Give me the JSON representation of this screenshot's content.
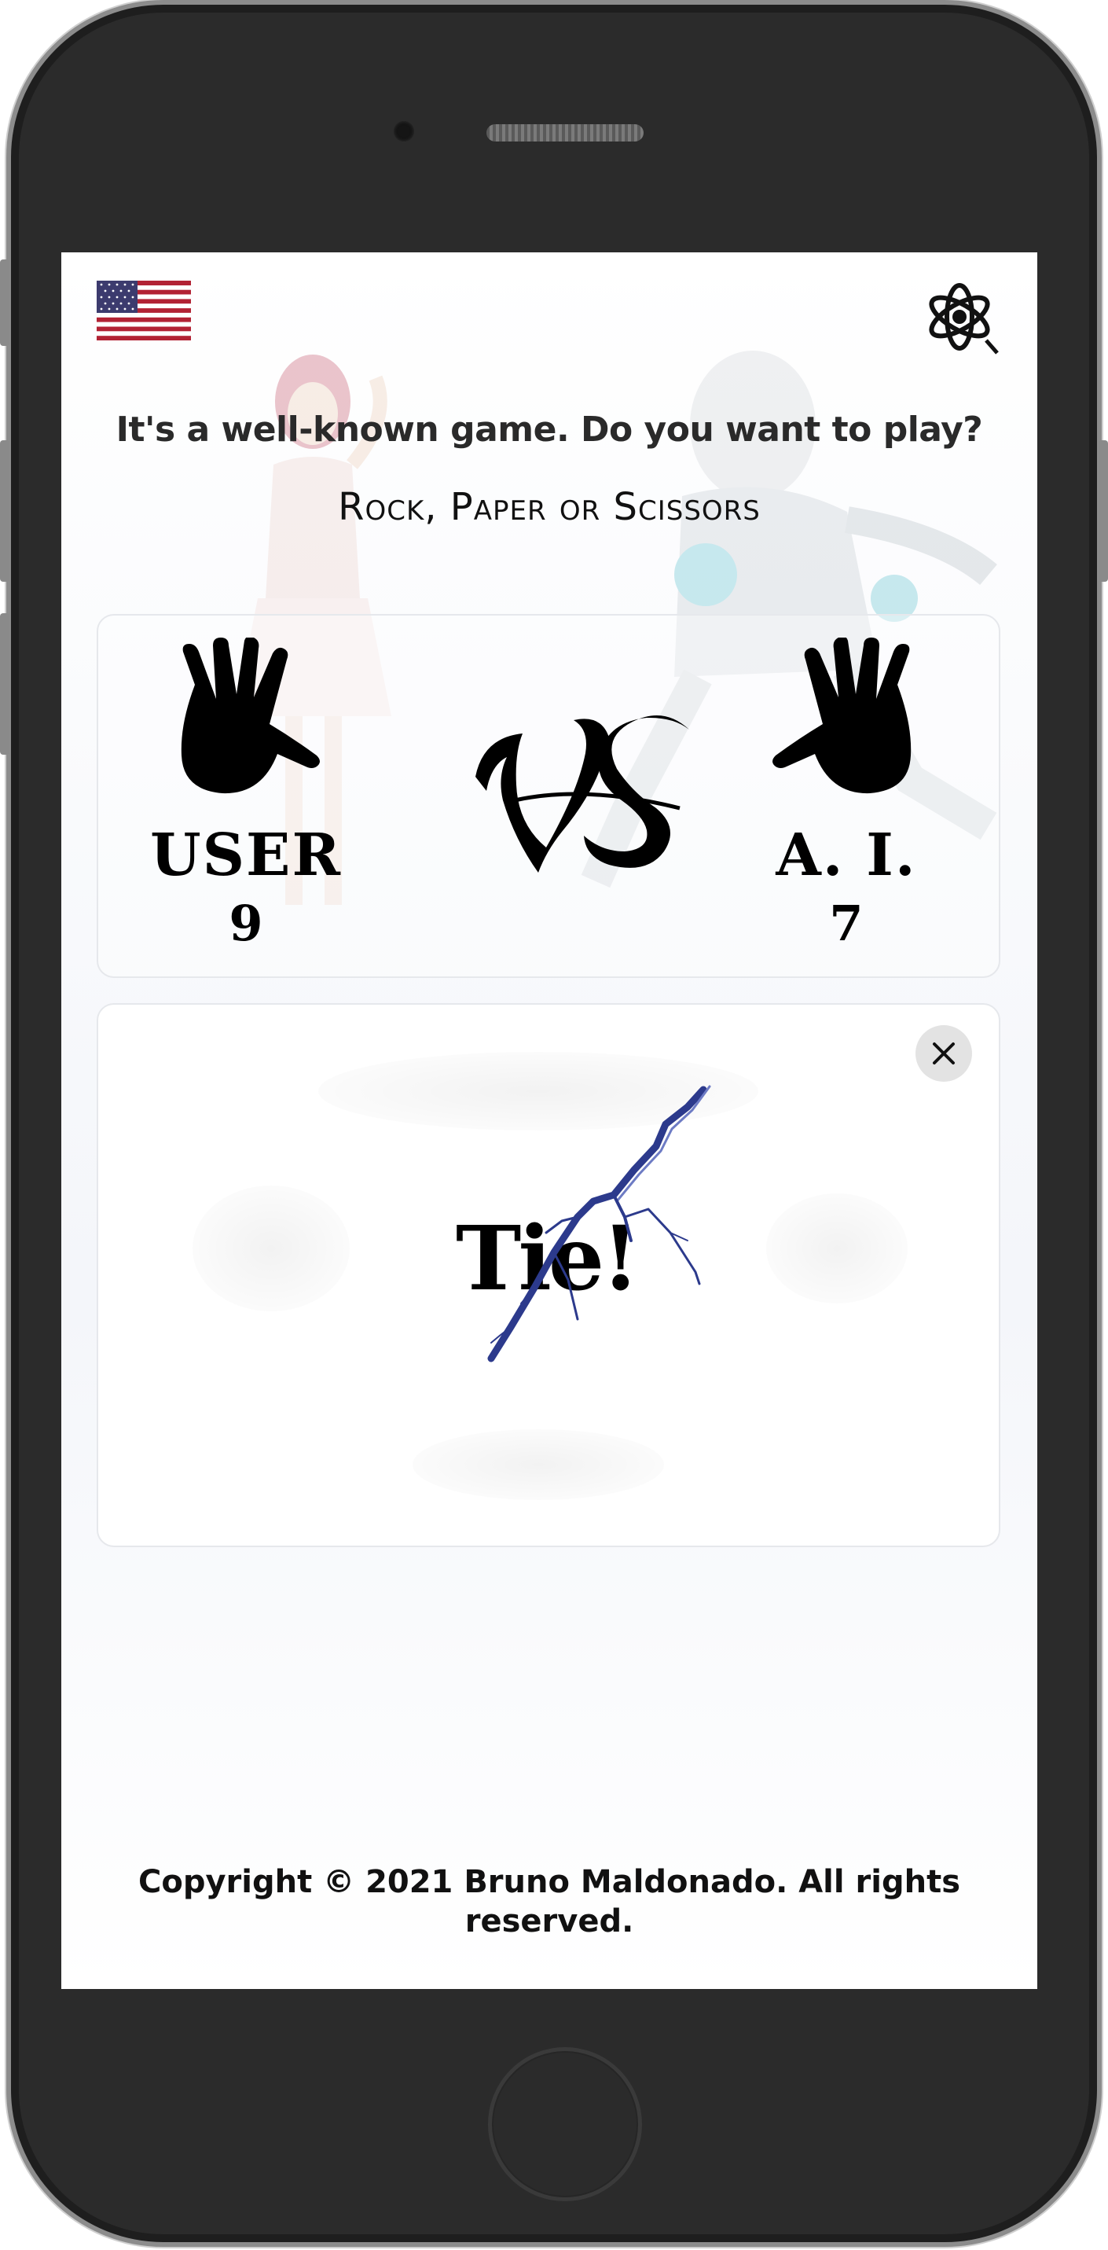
{
  "header": {
    "flag_icon": "us-flag-icon",
    "logo_icon": "atom-logo-icon"
  },
  "hero": {
    "headline": "It's a well-known game. Do you want to play?",
    "subtitle": "Rock, Paper or Scissors"
  },
  "scoreboard": {
    "user": {
      "label": "USER",
      "score": "9",
      "choice_icon": "open-hand-icon"
    },
    "vs_icon": "vs-gothic-icon",
    "ai": {
      "label": "A. I.",
      "score": "7",
      "choice_icon": "open-hand-icon"
    }
  },
  "result": {
    "text": "Tie!",
    "effect_icon": "lightning-bolt-icon",
    "close_icon": "close-icon"
  },
  "footer": {
    "copyright": "Copyright © 2021 Bruno Maldonado. All rights reserved."
  },
  "colors": {
    "frame": "#2b2b2b",
    "text": "#111111",
    "bolt": "#2c3a8c",
    "flag_red": "#b22234",
    "flag_blue": "#3c3b6e"
  }
}
